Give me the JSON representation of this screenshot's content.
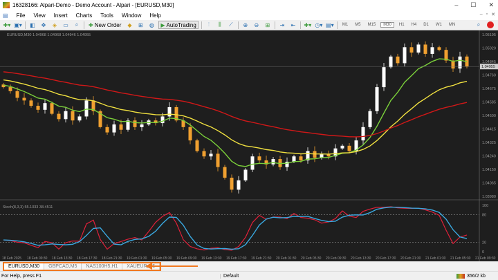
{
  "window": {
    "title": "16328166: Alpari-Demo - Demo Account - Alpari - [EURUSD,M30]",
    "controls": [
      "–",
      "☐",
      "✕"
    ]
  },
  "menu": [
    "File",
    "View",
    "Insert",
    "Charts",
    "Tools",
    "Window",
    "Help"
  ],
  "toolbar": {
    "new_order": "New Order",
    "autotrading": "AutoTrading",
    "timeframes": [
      "M1",
      "M5",
      "M15",
      "M30",
      "H1",
      "H4",
      "D1",
      "W1",
      "MN"
    ],
    "active_timeframe": "M30"
  },
  "chart": {
    "header": "EURUSD,M30  1.04968 1.04968 1.04946 1.04955",
    "symbol": "EURUSD",
    "timeframe": "M30",
    "current_price": "1.04955",
    "price_labels": [
      "1.05195",
      "1.05020",
      "1.04845",
      "1.04760",
      "1.04675",
      "1.04585",
      "1.04500",
      "1.04415",
      "1.04325",
      "1.04240",
      "1.04150",
      "1.04065",
      "1.03980"
    ],
    "price_range": [
      1.0398,
      1.05195
    ],
    "closes": [
      1.048,
      1.0477,
      1.0472,
      1.047,
      1.0466,
      1.0463,
      1.0468,
      1.046,
      1.0456,
      1.0462,
      1.0455,
      1.0458,
      1.047,
      1.0462,
      1.045,
      1.0446,
      1.0452,
      1.0448,
      1.0455,
      1.045,
      1.0452,
      1.0455,
      1.0453,
      1.0458,
      1.0465,
      1.0455,
      1.045,
      1.044,
      1.0432,
      1.0428,
      1.043,
      1.042,
      1.0412,
      1.0403,
      1.041,
      1.0418,
      1.0428,
      1.0425,
      1.0422,
      1.0426,
      1.042,
      1.0424,
      1.0428,
      1.0425,
      1.0432,
      1.0427,
      1.043,
      1.0428,
      1.0434,
      1.0436,
      1.0432,
      1.044,
      1.045,
      1.0462,
      1.048,
      1.0495,
      1.0503,
      1.0498,
      1.051,
      1.0506,
      1.0512,
      1.0505,
      1.051,
      1.0508,
      1.05,
      1.0494,
      1.0503,
      1.04955
    ],
    "colors": {
      "bull": "#ffffff",
      "bear": "#f0a030",
      "ma_fast": "#7bd03a",
      "ma_mid": "#f0e040",
      "ma_slow": "#d01818",
      "stoch_main": "#e0203a",
      "stoch_signal": "#3aa8e0"
    },
    "stoch": {
      "label": "Stoch(8,3,3) 55.1033 38.4511",
      "levels": [
        "100",
        "80",
        "20",
        "0"
      ]
    },
    "time_labels": [
      "18 Feb 2025",
      "18 Feb 09:30",
      "18 Feb 13:30",
      "18 Feb 17:30",
      "18 Feb 21:30",
      "19 Feb 01:30",
      "19 Feb 05:30",
      "19 Feb 09:30",
      "19 Feb 13:30",
      "19 Feb 17:30",
      "19 Feb 21:30",
      "20 Feb 01:30",
      "20 Feb 05:30",
      "20 Feb 09:30",
      "20 Feb 13:30",
      "20 Feb 17:30",
      "20 Feb 21:30",
      "21 Feb 01:30",
      "21 Feb 05:30",
      "21 Feb 09:30"
    ]
  },
  "tabs": [
    "EURUSD,M30",
    "GBPCAD,M5",
    "NAS100H5,H1",
    "XAUEUR,M5"
  ],
  "active_tab": "EURUSD,M30",
  "status": {
    "help": "For Help, press F1",
    "profile": "Default",
    "traffic": "356/2 kb"
  },
  "annotation_color": "#f07820"
}
